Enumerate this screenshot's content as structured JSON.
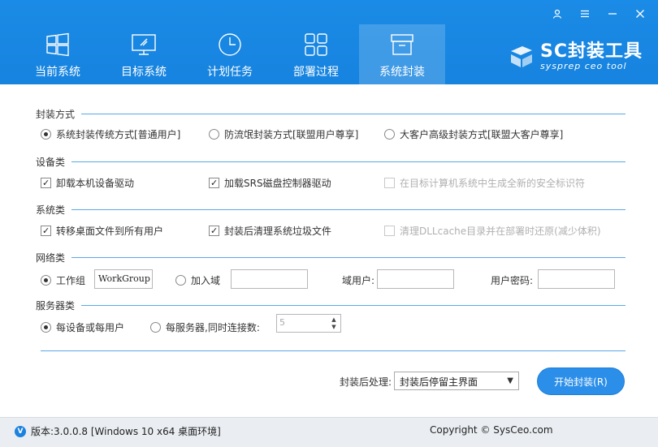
{
  "window": {
    "controls": [
      "user-icon",
      "menu-icon",
      "minimize-icon",
      "close-icon"
    ]
  },
  "tabs": [
    {
      "label": "当前系统",
      "icon": "windows-logo-icon",
      "active": false
    },
    {
      "label": "目标系统",
      "icon": "monitor-icon",
      "active": false
    },
    {
      "label": "计划任务",
      "icon": "clock-icon",
      "active": false
    },
    {
      "label": "部署过程",
      "icon": "grid-icon",
      "active": false
    },
    {
      "label": "系统封装",
      "icon": "archive-box-icon",
      "active": true
    }
  ],
  "logo": {
    "title": "SC封装工具",
    "subtitle": "sysprep ceo tool"
  },
  "sections": {
    "package_mode": {
      "title": "封装方式",
      "options": [
        {
          "label": "系统封装传统方式[普通用户]",
          "selected": true
        },
        {
          "label": "防流氓封装方式[联盟用户尊享]",
          "selected": false
        },
        {
          "label": "大客户高级封装方式[联盟大客户尊享]",
          "selected": false
        }
      ]
    },
    "device": {
      "title": "设备类",
      "options": [
        {
          "label": "卸载本机设备驱动",
          "checked": true,
          "disabled": false
        },
        {
          "label": "加载SRS磁盘控制器驱动",
          "checked": true,
          "disabled": false
        },
        {
          "label": "在目标计算机系统中生成全新的安全标识符",
          "checked": false,
          "disabled": true
        }
      ]
    },
    "system": {
      "title": "系统类",
      "options": [
        {
          "label": "转移桌面文件到所有用户",
          "checked": true,
          "disabled": false
        },
        {
          "label": "封装后清理系统垃圾文件",
          "checked": true,
          "disabled": false
        },
        {
          "label": "清理DLLcache目录并在部署时还原(减少体积)",
          "checked": false,
          "disabled": true
        }
      ]
    },
    "network": {
      "title": "网络类",
      "workgroup_label": "工作组",
      "workgroup_value": "WorkGroup",
      "join_domain_label": "加入域",
      "domain_value": "",
      "domain_user_label": "域用户:",
      "domain_user_value": "",
      "user_password_label": "用户密码:",
      "user_password_value": ""
    },
    "server": {
      "title": "服务器类",
      "per_device_label": "每设备或每用户",
      "per_server_label": "每服务器,同时连接数:",
      "connections_value": "5"
    }
  },
  "after_package": {
    "label": "封装后处理:",
    "selected": "封装后停留主界面"
  },
  "start_button": "开始封装(R)",
  "footer": {
    "version": "版本:3.0.0.8 [Windows 10 x64 桌面环境]",
    "copyright": "Copyright © SysCeo.com"
  },
  "colors": {
    "header": "#1683df",
    "accent_line": "#5aa9e6",
    "button": "#2b8ee8",
    "footer_bg": "#eaeef2"
  }
}
